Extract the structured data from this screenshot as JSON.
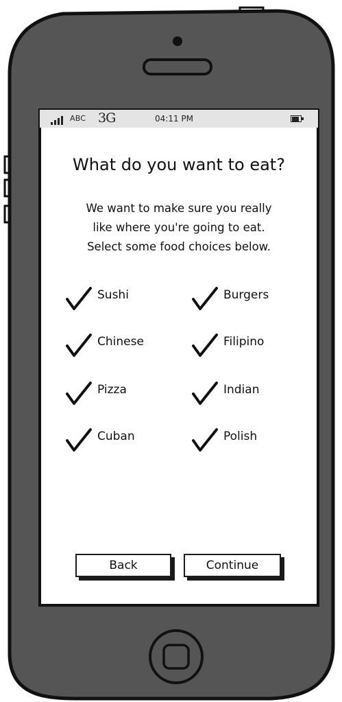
{
  "status_bar": {
    "carrier": "ABC",
    "network": "3G",
    "time": "04:11 PM",
    "signal_icon": "signal-bars-icon",
    "battery_icon": "battery-icon"
  },
  "screen": {
    "title": "What do you want to eat?",
    "description_lines": [
      "We want to make sure you really",
      "like where you're going to eat.",
      "Select some food choices below."
    ],
    "choices": [
      {
        "label": "Sushi",
        "checked": true
      },
      {
        "label": "Burgers",
        "checked": true
      },
      {
        "label": "Chinese",
        "checked": true
      },
      {
        "label": "Filipino",
        "checked": true
      },
      {
        "label": "Pizza",
        "checked": true
      },
      {
        "label": "Indian",
        "checked": true
      },
      {
        "label": "Cuban",
        "checked": true
      },
      {
        "label": "Polish",
        "checked": true
      }
    ],
    "back_label": "Back",
    "continue_label": "Continue"
  },
  "colors": {
    "phone_body": "#555555",
    "phone_outline": "#111111",
    "screen_bg": "#ffffff",
    "status_bar_bg": "#e4e4e4"
  }
}
